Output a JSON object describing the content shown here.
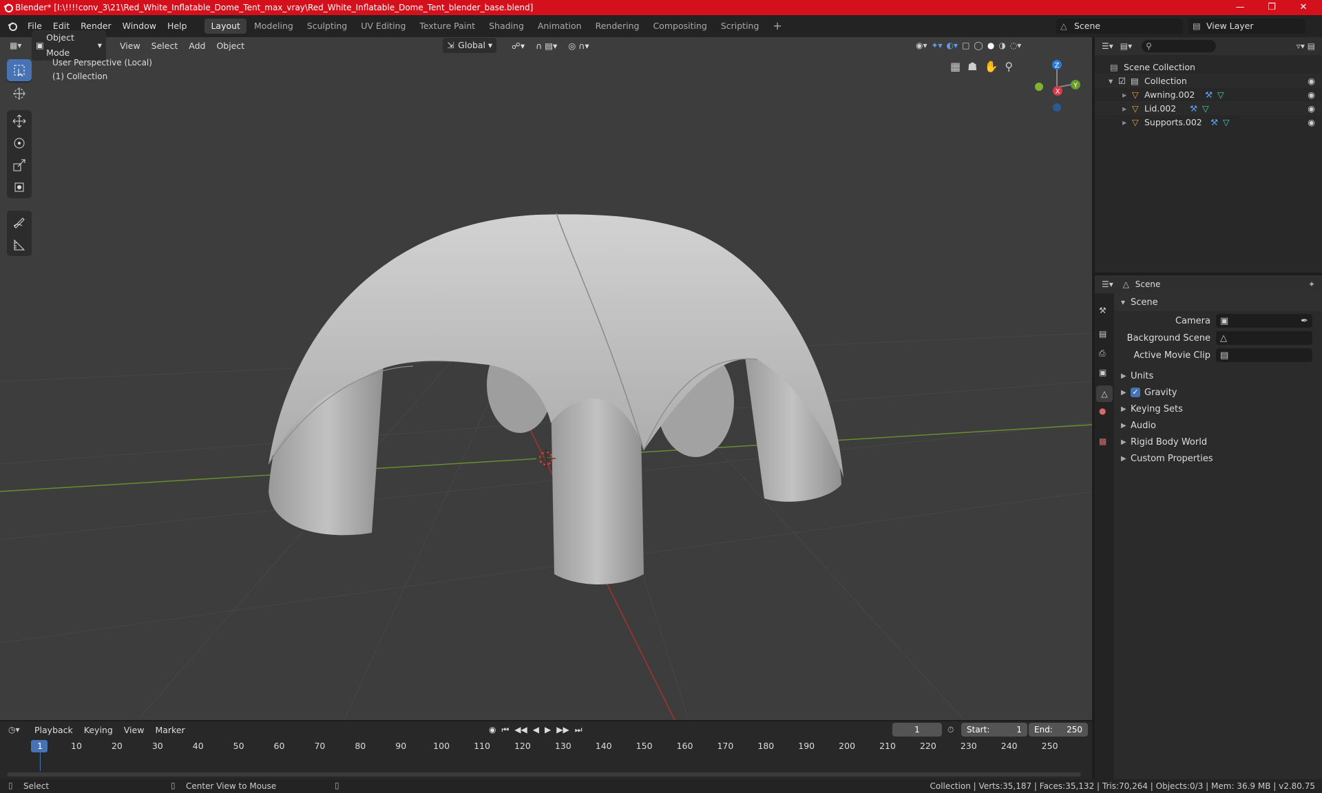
{
  "window": {
    "title": "Blender* [I:\\!!!!conv_3\\21\\Red_White_Inflatable_Dome_Tent_max_vray\\Red_White_Inflatable_Dome_Tent_blender_base.blend]"
  },
  "menu": [
    "File",
    "Edit",
    "Render",
    "Window",
    "Help"
  ],
  "workspaces": [
    "Layout",
    "Modeling",
    "Sculpting",
    "UV Editing",
    "Texture Paint",
    "Shading",
    "Animation",
    "Rendering",
    "Compositing",
    "Scripting"
  ],
  "active_workspace": "Layout",
  "scene_field": "Scene",
  "view_layer_field": "View Layer",
  "viewport": {
    "mode": "Object Mode",
    "menus": [
      "View",
      "Select",
      "Add",
      "Object"
    ],
    "orientation": "Global",
    "overlay_line1": "User Perspective (Local)",
    "overlay_line2": "(1) Collection",
    "gizmo": {
      "z": "Z",
      "y": "Y",
      "x": "X"
    }
  },
  "outliner": {
    "root": "Scene Collection",
    "collection": "Collection",
    "objects": [
      "Awning.002",
      "Lid.002",
      "Supports.002"
    ]
  },
  "properties": {
    "header": "Scene",
    "panel": "Scene",
    "fields": [
      {
        "label": "Camera",
        "value": ""
      },
      {
        "label": "Background Scene",
        "value": ""
      },
      {
        "label": "Active Movie Clip",
        "value": ""
      }
    ],
    "sections": [
      "Units",
      "Gravity",
      "Keying Sets",
      "Audio",
      "Rigid Body World",
      "Custom Properties"
    ],
    "gravity_checked": true
  },
  "timeline": {
    "menus": [
      "Playback",
      "Keying",
      "View",
      "Marker"
    ],
    "current_frame": "1",
    "start_label": "Start:",
    "start": "1",
    "end_label": "End:",
    "end": "250",
    "ticks": [
      "1",
      "10",
      "20",
      "30",
      "40",
      "50",
      "60",
      "70",
      "80",
      "90",
      "100",
      "110",
      "120",
      "130",
      "140",
      "150",
      "160",
      "170",
      "180",
      "190",
      "200",
      "210",
      "220",
      "230",
      "240",
      "250"
    ]
  },
  "status": {
    "left": "Select",
    "middle": "Center View to Mouse",
    "right": "Collection | Verts:35,187 | Faces:35,132 | Tris:70,264 | Objects:0/3 | Mem: 36.9 MB | v2.80.75"
  },
  "colors": {
    "title_bar": "#d4101d",
    "accent": "#4772b3",
    "viewport_bg": "#3d3d3d"
  }
}
